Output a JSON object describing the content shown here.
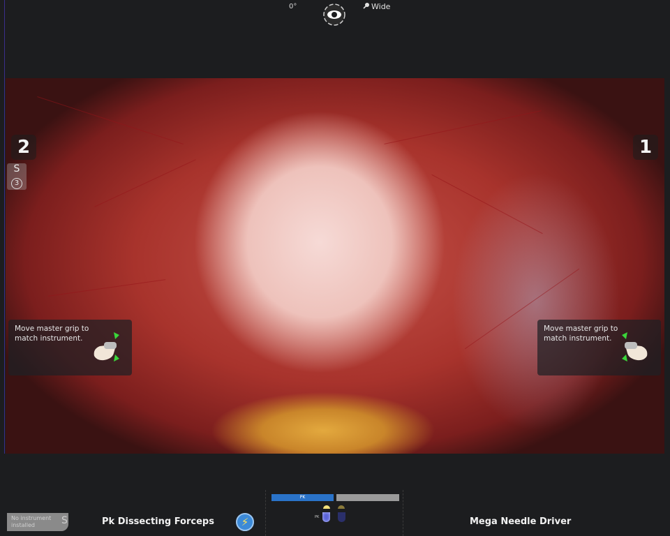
{
  "header": {
    "angle": "0°",
    "zoom_label": "Wide"
  },
  "overlays": {
    "left_arm_number": "2",
    "right_arm_number": "1",
    "left_side_letter": "S",
    "left_side_arm": "3",
    "left_message": "Move master grip to match instrument.",
    "right_message": "Move master grip to match instrument."
  },
  "footer": {
    "left_status": "No instrument installed",
    "left_letter": "S",
    "left_instrument": "Pk Dissecting Forceps",
    "right_instrument": "Mega Needle Driver",
    "energy_active_label": "PK",
    "energy_small_label": "PK"
  },
  "colors": {
    "energy_active": "#2a73c9",
    "energy_inactive": "#9a9a9a",
    "pedal_yellow": "#f3e07a",
    "pedal_blue": "#5a63d8",
    "grip_arrow_green": "#3ad63a"
  }
}
